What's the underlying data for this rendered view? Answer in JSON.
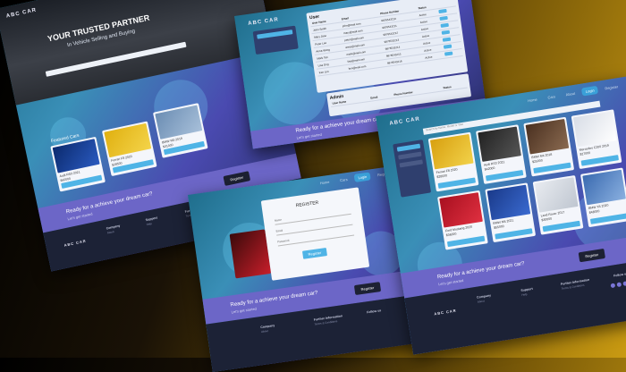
{
  "brand": "ABC CAR",
  "nav": [
    "Home",
    "Cars",
    "About",
    "Login",
    "Register"
  ],
  "hero": {
    "title": "YOUR TRUSTED PARTNER",
    "subtitle": "In Vehicle Selling and Buying"
  },
  "section_featured": "Featured Cars",
  "cars": [
    {
      "name": "Audi RS3 2021",
      "price": "$42000",
      "button": "View Details"
    },
    {
      "name": "Ferrari F8 2020",
      "price": "$28500",
      "button": "View Details"
    },
    {
      "name": "BMW M3 2019",
      "price": "$31000",
      "button": "View Details"
    }
  ],
  "cta": {
    "text": "Ready for a achieve your dream car?",
    "sub": "Let's get started",
    "button": "Register"
  },
  "footer": {
    "cols": [
      {
        "title": "Company",
        "items": [
          "About",
          "Careers"
        ]
      },
      {
        "title": "Support",
        "items": [
          "Help",
          "Contact Us"
        ]
      },
      {
        "title": "Further Information",
        "items": [
          "Terms & Conditions",
          "Privacy Policy"
        ]
      },
      {
        "title": "Follow us",
        "items": []
      }
    ]
  },
  "admin_panel": {
    "section_user": "User",
    "section_admin": "Admin",
    "columns": [
      "User Name",
      "Email",
      "Phone Number",
      "Status"
    ],
    "rows": [
      [
        "John Smith",
        "john@mail.com",
        "9876543210",
        "Active"
      ],
      [
        "Mary Jane",
        "mary@mail.com",
        "9876543211",
        "Active"
      ],
      [
        "Peter Lee",
        "peter@mail.com",
        "9876543212",
        "Active"
      ],
      [
        "Anna Wong",
        "anna@mail.com",
        "9876543213",
        "Active"
      ],
      [
        "Mark Tan",
        "mark@mail.com",
        "9876543214",
        "Active"
      ],
      [
        "Lisa Ong",
        "lisa@mail.com",
        "9876543215",
        "Active"
      ],
      [
        "Ken Lim",
        "ken@mail.com",
        "9876543216",
        "Active"
      ]
    ],
    "admin_columns": [
      "User Name",
      "Email",
      "Phone Number",
      "Status"
    ]
  },
  "register_form": {
    "title": "REGISTER",
    "fields": [
      "Name",
      "Email",
      "Password"
    ],
    "button": "Register"
  },
  "listing": {
    "search_placeholder": "Search by Name, Model or Year",
    "filter_button": "Search",
    "cars": [
      {
        "name": "Ferrari F8 2020",
        "price": "$28500"
      },
      {
        "name": "Audi RS3 2021",
        "price": "$42000"
      },
      {
        "name": "BMW M4 2018",
        "price": "$25000"
      },
      {
        "name": "Mercedes C200 2019",
        "price": "$27000"
      },
      {
        "name": "Ford Mustang 2020",
        "price": "$36000"
      },
      {
        "name": "BMW M5 2021",
        "price": "$55000"
      },
      {
        "name": "Land Rover 2017",
        "price": "$30000"
      },
      {
        "name": "BMW X5 2020",
        "price": "$48000"
      }
    ],
    "button": "View Details"
  },
  "colors": {
    "accent": "#4fb4e6",
    "band": "#6c66c7",
    "footer": "#1c2236",
    "bg": "#c99a12"
  }
}
